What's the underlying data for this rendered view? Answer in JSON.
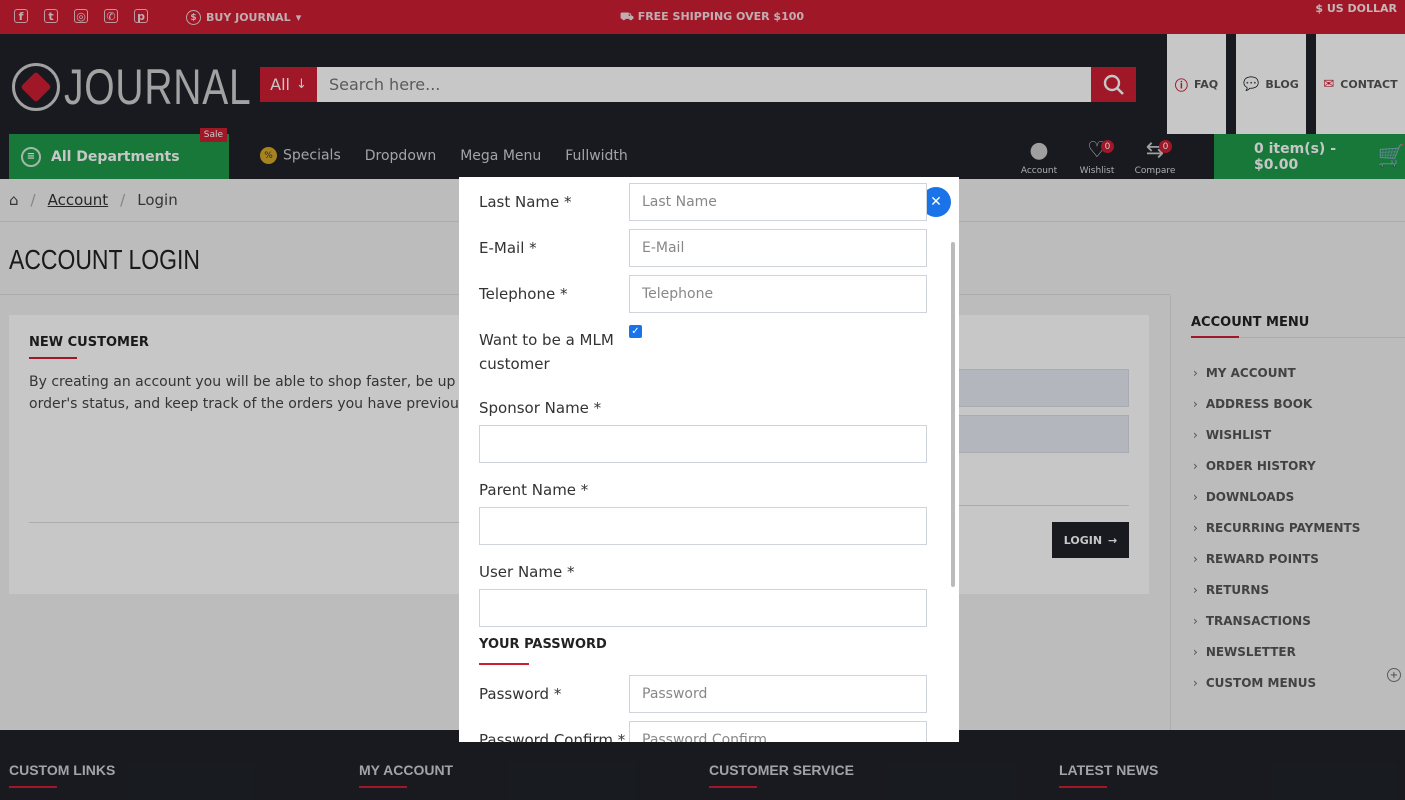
{
  "topbar": {
    "social_icons": [
      "facebook-icon",
      "twitter-icon",
      "instagram-icon",
      "whatsapp-icon",
      "pinterest-icon"
    ],
    "buy_label": "BUY JOURNAL",
    "shipping": "FREE SHIPPING OVER $100",
    "currency": "$ US DOLLAR"
  },
  "header": {
    "logo_text": "JOURNAL",
    "search_category": "All",
    "search_placeholder": "Search here...",
    "links": [
      {
        "label": "FAQ",
        "icon": "question-icon"
      },
      {
        "label": "BLOG",
        "icon": "chat-icon"
      },
      {
        "label": "CONTACT",
        "icon": "mail-icon"
      }
    ]
  },
  "nav": {
    "departments": "All Departments",
    "sale_badge": "Sale",
    "pct_icon": "%",
    "menu": [
      "Specials",
      "Dropdown",
      "Mega Menu",
      "Fullwidth"
    ],
    "account": "Account",
    "wishlist": "Wishlist",
    "wishlist_count": "0",
    "compare": "Compare",
    "compare_count": "0",
    "cart": "0 item(s) - $0.00"
  },
  "breadcrumb": {
    "account": "Account",
    "login": "Login"
  },
  "page": {
    "title": "ACCOUNT LOGIN",
    "new_customer_title": "NEW CUSTOMER",
    "new_customer_text": "By creating an account you will be able to shop faster, be up to d order's status, and keep track of the orders you have previously",
    "login_button": "LOGIN"
  },
  "sidebar": {
    "title": "ACCOUNT MENU",
    "items": [
      "MY ACCOUNT",
      "ADDRESS BOOK",
      "WISHLIST",
      "ORDER HISTORY",
      "DOWNLOADS",
      "RECURRING PAYMENTS",
      "REWARD POINTS",
      "RETURNS",
      "TRANSACTIONS",
      "NEWSLETTER",
      "CUSTOM MENUS"
    ]
  },
  "footer": {
    "cols": [
      "CUSTOM LINKS",
      "MY ACCOUNT",
      "CUSTOMER SERVICE",
      "LATEST NEWS"
    ]
  },
  "modal": {
    "last_name_label": "Last Name *",
    "last_name_placeholder": "Last Name",
    "email_label": "E-Mail *",
    "email_placeholder": "E-Mail",
    "telephone_label": "Telephone *",
    "telephone_placeholder": "Telephone",
    "mlm_label": "Want to be a MLM customer",
    "mlm_checked": true,
    "sponsor_label": "Sponsor Name *",
    "parent_label": "Parent Name *",
    "username_label": "User Name *",
    "password_section": "YOUR PASSWORD",
    "password_label": "Password *",
    "password_placeholder": "Password",
    "confirm_label": "Password Confirm *",
    "confirm_placeholder": "Password Confirm"
  }
}
